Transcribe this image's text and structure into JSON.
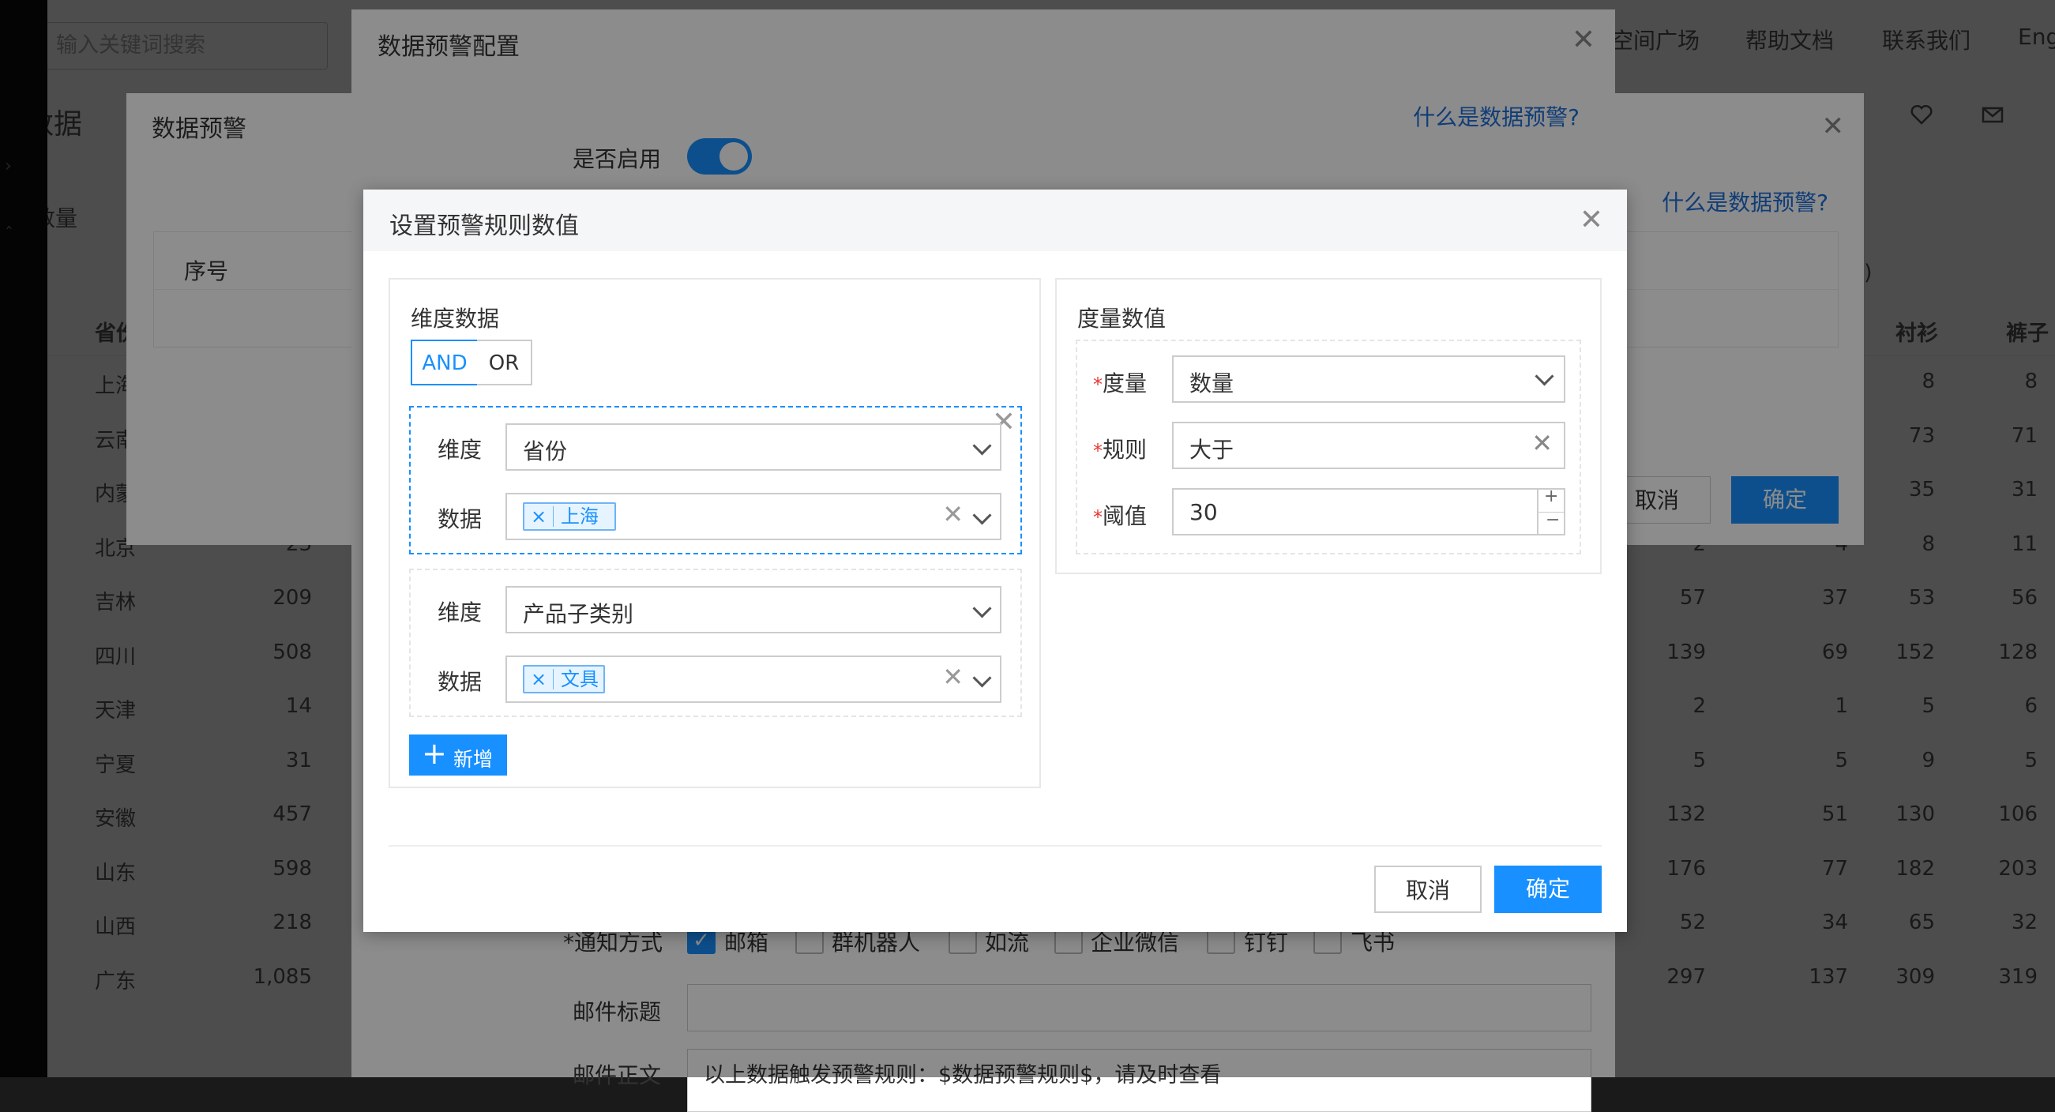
{
  "background": {
    "search_placeholder": "输入关键词搜索",
    "nav": [
      "空间广场",
      "帮助文档",
      "联系我们",
      "Eng"
    ],
    "heading": "数据",
    "qty_label": "数量",
    "columns": {
      "province": "省份",
      "shirt": "衬衫",
      "pants": "裤子",
      "paren": ")"
    },
    "rows": [
      {
        "province": "上海",
        "count": "",
        "c1": "",
        "c2": "",
        "c3": "8",
        "c4": "8"
      },
      {
        "province": "云南",
        "count": "",
        "c1": "",
        "c2": "",
        "c3": "73",
        "c4": "71"
      },
      {
        "province": "内蒙",
        "count": "",
        "c1": "",
        "c2": "",
        "c3": "35",
        "c4": "31"
      },
      {
        "province": "北京",
        "count": "23",
        "c1": "2",
        "c2": "4",
        "c3": "8",
        "c4": "11"
      },
      {
        "province": "吉林",
        "count": "209",
        "c1": "57",
        "c2": "37",
        "c3": "53",
        "c4": "56"
      },
      {
        "province": "四川",
        "count": "508",
        "c1": "139",
        "c2": "69",
        "c3": "152",
        "c4": "128"
      },
      {
        "province": "天津",
        "count": "14",
        "c1": "2",
        "c2": "1",
        "c3": "5",
        "c4": "6"
      },
      {
        "province": "宁夏",
        "count": "31",
        "c1": "5",
        "c2": "5",
        "c3": "9",
        "c4": "5"
      },
      {
        "province": "安徽",
        "count": "457",
        "c1": "132",
        "c2": "51",
        "c3": "130",
        "c4": "106"
      },
      {
        "province": "山东",
        "count": "598",
        "c1": "176",
        "c2": "77",
        "c3": "182",
        "c4": "203"
      },
      {
        "province": "山西",
        "count": "218",
        "c1": "52",
        "c2": "34",
        "c3": "65",
        "c4": "32"
      },
      {
        "province": "广东",
        "count": "1,085",
        "c1": "297",
        "c2": "137",
        "c3": "309",
        "c4": "319"
      }
    ]
  },
  "dialog_alert": {
    "title": "数据预警",
    "help_link": "什么是数据预警?",
    "table_header": "序号",
    "cancel": "取消",
    "ok": "确定"
  },
  "dialog_config": {
    "title": "数据预警配置",
    "help_link": "什么是数据预警?",
    "enable_label": "是否启用",
    "enabled": true,
    "notify_label": "*通知方式",
    "notify_options": [
      {
        "label": "邮箱",
        "checked": true
      },
      {
        "label": "群机器人",
        "checked": false
      },
      {
        "label": "如流",
        "checked": false
      },
      {
        "label": "企业微信",
        "checked": false
      },
      {
        "label": "钉钉",
        "checked": false
      },
      {
        "label": "飞书",
        "checked": false
      }
    ],
    "mail_subject_label": "邮件标题",
    "mail_body_label": "邮件正文",
    "mail_body_value": "以上数据触发预警规则：$数据预警规则$，请及时查看"
  },
  "dialog_rule": {
    "title": "设置预警规则数值",
    "dimension_panel": {
      "title": "维度数据",
      "logic_and": "AND",
      "logic_or": "OR",
      "dimension_label": "维度",
      "data_label": "数据",
      "conditions": [
        {
          "dimension": "省份",
          "tag": "上海"
        },
        {
          "dimension": "产品子类别",
          "tag": "文具"
        }
      ],
      "add_label": "新增"
    },
    "measure_panel": {
      "title": "度量数值",
      "measure_label": "度量",
      "measure_value": "数量",
      "rule_label": "规则",
      "rule_value": "大于",
      "threshold_label": "阈值",
      "threshold_value": "30"
    },
    "cancel": "取消",
    "ok": "确定"
  },
  "colors": {
    "primary": "#1890ff",
    "link": "#1e6fd9",
    "danger": "#e53935"
  }
}
